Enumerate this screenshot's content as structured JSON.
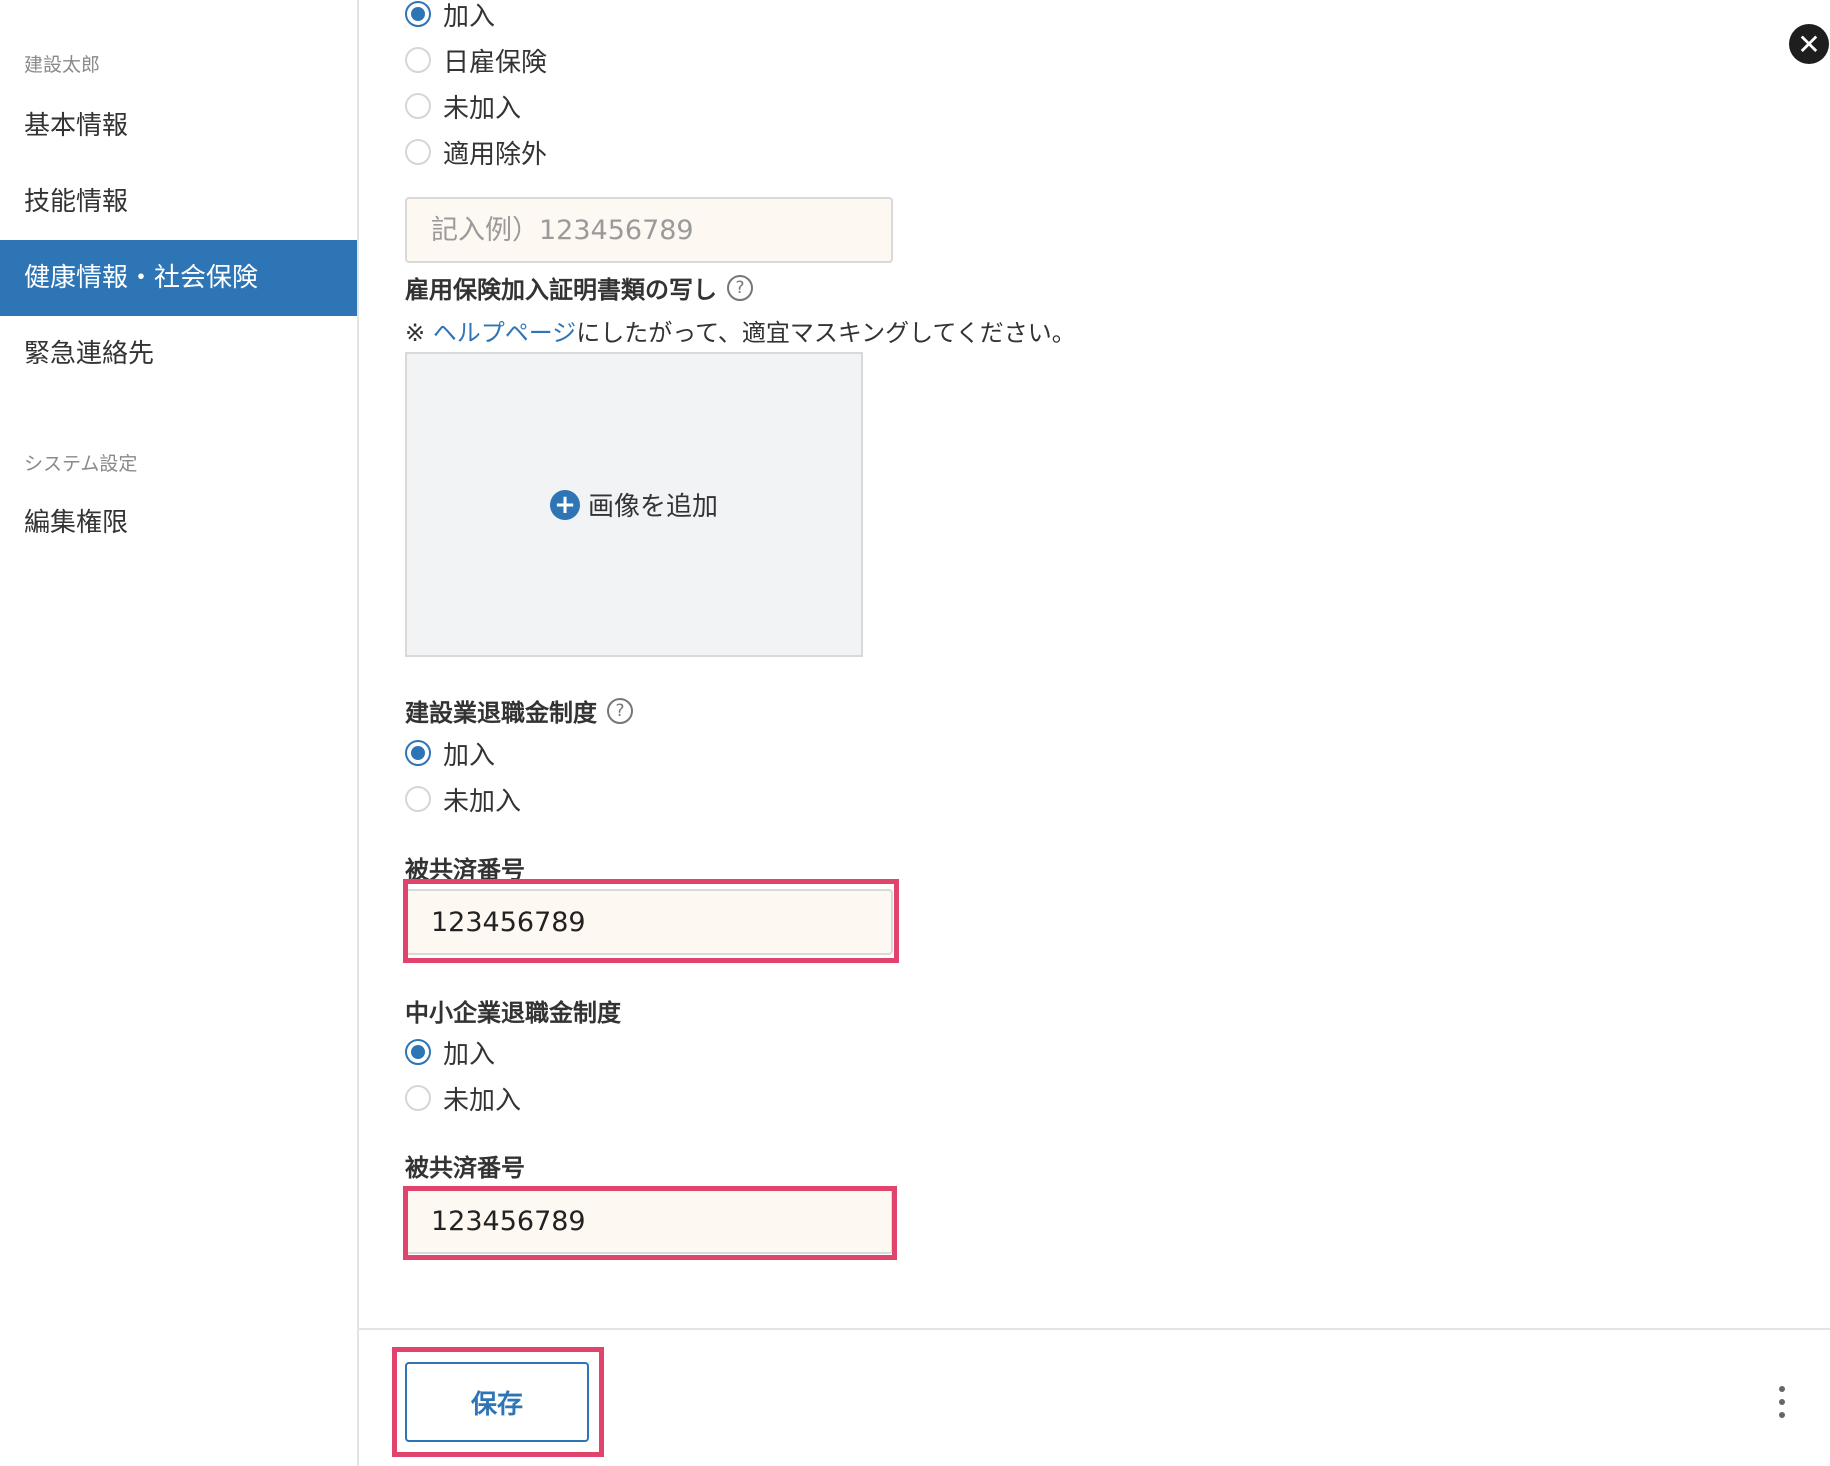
{
  "sidebar": {
    "user_name": "建設太郎",
    "items": [
      {
        "label": "基本情報"
      },
      {
        "label": "技能情報"
      },
      {
        "label": "健康情報・社会保険"
      },
      {
        "label": "緊急連絡先"
      }
    ],
    "system_section": "システム設定",
    "system_items": [
      {
        "label": "編集権限"
      }
    ]
  },
  "employment_insurance": {
    "options": [
      {
        "label": "加入",
        "checked": true
      },
      {
        "label": "日雇保険",
        "checked": false
      },
      {
        "label": "未加入",
        "checked": false
      },
      {
        "label": "適用除外",
        "checked": false
      }
    ],
    "number_placeholder": "記入例）123456789",
    "document_label": "雇用保険加入証明書類の写し",
    "note_prefix": "※ ",
    "note_link": "ヘルプページ",
    "note_suffix": "にしたがって、適宜マスキングしてください。",
    "upload_label": "画像を追加"
  },
  "construction_retirement": {
    "label": "建設業退職金制度",
    "options": [
      {
        "label": "加入",
        "checked": true
      },
      {
        "label": "未加入",
        "checked": false
      }
    ],
    "number_label": "被共済番号",
    "number_value": "123456789"
  },
  "sme_retirement": {
    "label": "中小企業退職金制度",
    "options": [
      {
        "label": "加入",
        "checked": true
      },
      {
        "label": "未加入",
        "checked": false
      }
    ],
    "number_label": "被共済番号",
    "number_value": "123456789"
  },
  "footer": {
    "save_label": "保存"
  },
  "icons": {
    "help": "?",
    "plus": "+",
    "close": "✕"
  },
  "colors": {
    "accent": "#2e75b6",
    "highlight": "#e0436b",
    "input_bg": "#fdf8f2"
  }
}
